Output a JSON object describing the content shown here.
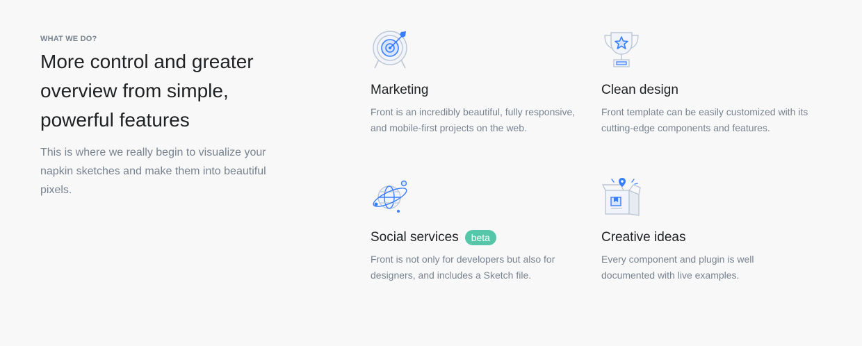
{
  "intro": {
    "eyebrow": "WHAT WE DO?",
    "headline": "More control and greater overview from simple, powerful features",
    "lead": "This is where we really begin to visualize your napkin sketches and make them into beautiful pixels."
  },
  "features": [
    {
      "icon": "target-icon",
      "title": "Marketing",
      "description": "Front is an incredibly beautiful, fully responsive, and mobile-first projects on the web."
    },
    {
      "icon": "trophy-icon",
      "title": "Clean design",
      "description": "Front template can be easily customized with its cutting-edge components and features."
    },
    {
      "icon": "globe-icon",
      "title": "Social services",
      "badge": "beta",
      "description": "Front is not only for developers but also for designers, and includes a Sketch file."
    },
    {
      "icon": "box-icon",
      "title": "Creative ideas",
      "description": "Every component and plugin is well documented with live examples."
    }
  ],
  "colors": {
    "primary": "#377dff",
    "badge": "#55c7a8",
    "muted": "#77838f",
    "heading": "#1e2022",
    "background": "#f8f8f9"
  }
}
